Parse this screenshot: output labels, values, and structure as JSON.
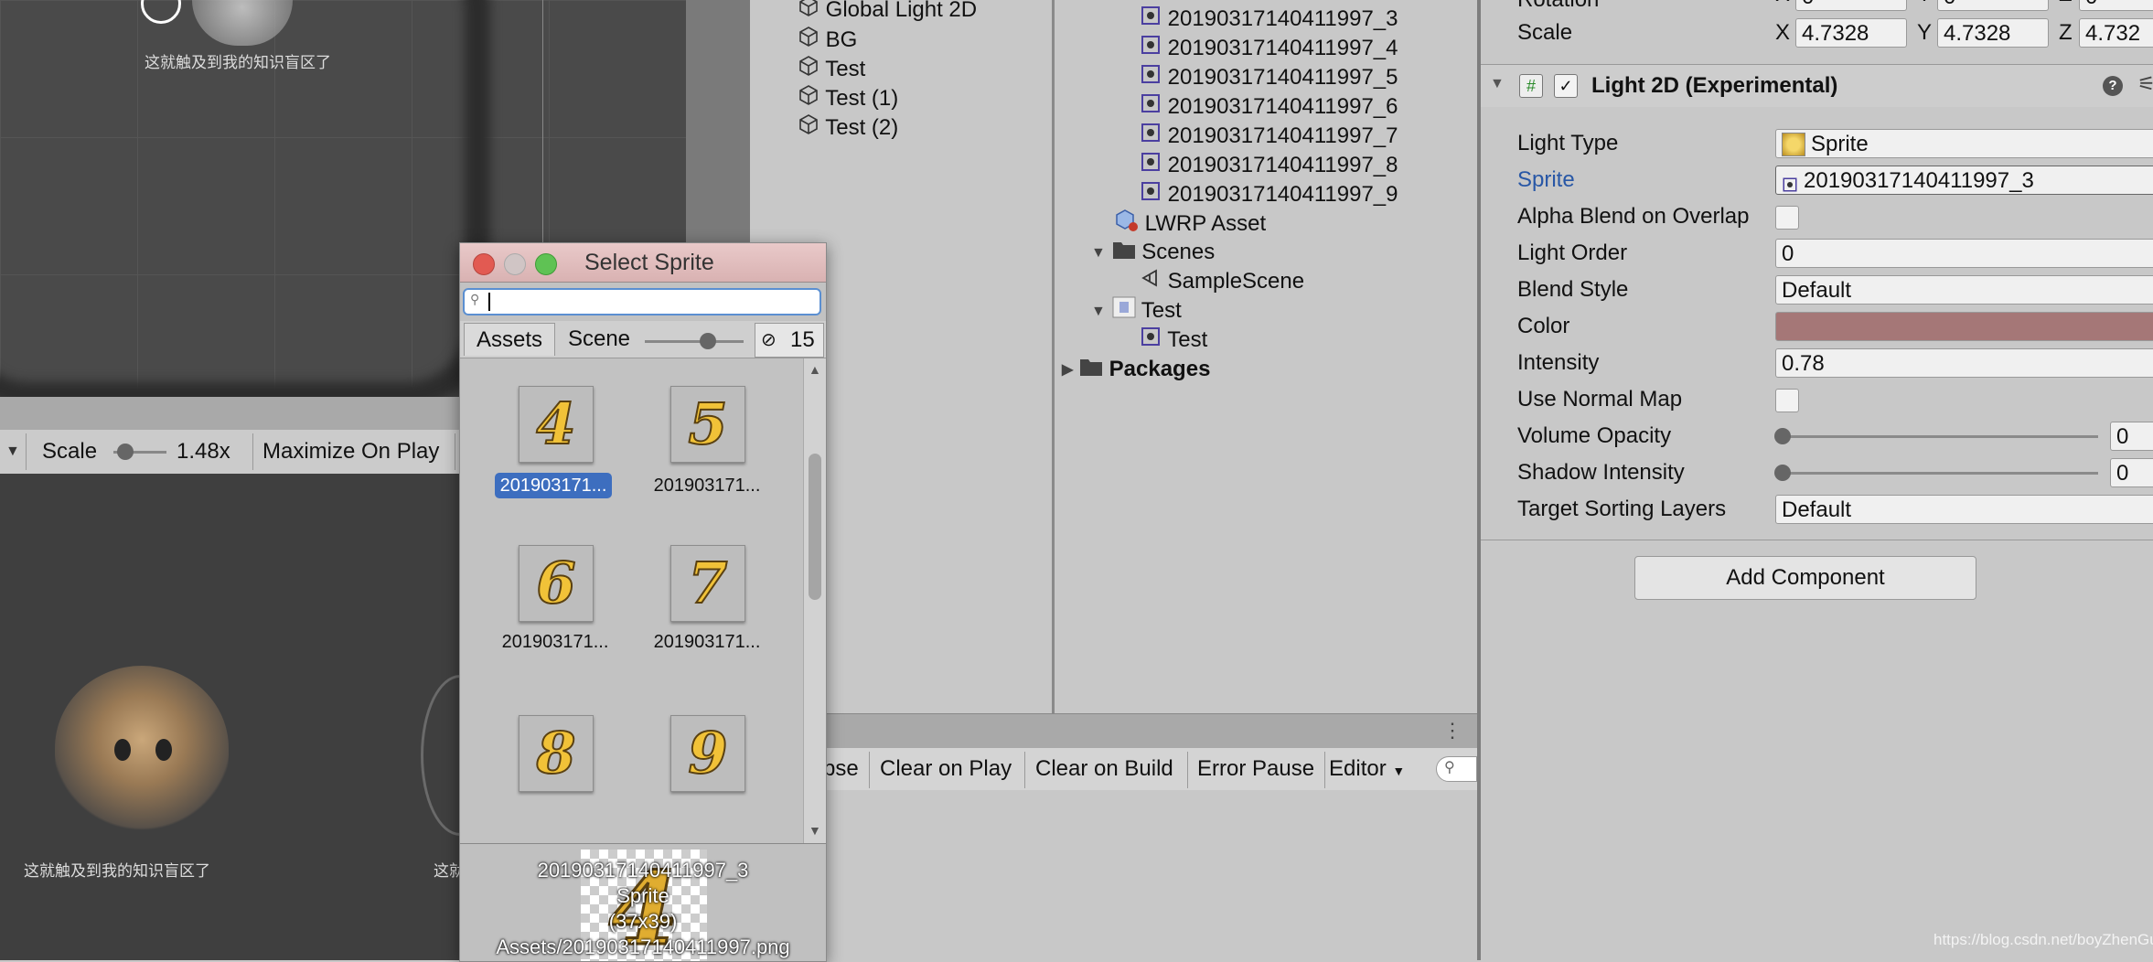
{
  "scene_caption_top": "这就触及到我的知识盲区了",
  "game_toolbar": {
    "scale_label": "Scale",
    "scale_value": "1.48x",
    "maximize": "Maximize On Play"
  },
  "game_caption": "这就触及到我的知识盲区了",
  "game_caption_partial": "这就",
  "hierarchy": {
    "items": [
      "Global Light 2D",
      "BG",
      "Test",
      "Test (1)",
      "Test (2)"
    ]
  },
  "project": {
    "sprites": [
      "20190317140411997_3",
      "20190317140411997_4",
      "20190317140411997_5",
      "20190317140411997_6",
      "20190317140411997_7",
      "20190317140411997_8",
      "20190317140411997_9"
    ],
    "lwrp": "LWRP Asset",
    "scenes_folder": "Scenes",
    "sample_scene": "SampleScene",
    "test_folder": "Test",
    "test_sprite": "Test",
    "packages": "Packages"
  },
  "console": {
    "collapse_partial": "pse",
    "clear_on_play": "Clear on Play",
    "clear_on_build": "Clear on Build",
    "error_pause": "Error Pause",
    "editor": "Editor"
  },
  "inspector": {
    "rotation_label": "Rotation",
    "scale_label": "Scale",
    "x": "X",
    "y": "Y",
    "z": "Z",
    "scale_x": "4.7328",
    "scale_y": "4.7328",
    "scale_z": "4.732",
    "rot_x": "0",
    "rot_y": "0",
    "rot_z": "0",
    "component_title": "Light 2D (Experimental)",
    "light_type_label": "Light Type",
    "light_type_value": "Sprite",
    "sprite_label": "Sprite",
    "sprite_value": "20190317140411997_3",
    "alpha_blend_label": "Alpha Blend on Overlap",
    "alpha_blend_checked": false,
    "light_order_label": "Light Order",
    "light_order_value": "0",
    "blend_style_label": "Blend Style",
    "blend_style_value": "Default",
    "color_label": "Color",
    "color_value": "#a57777",
    "intensity_label": "Intensity",
    "intensity_value": "0.78",
    "use_normal_map_label": "Use Normal Map",
    "use_normal_map_checked": false,
    "volume_opacity_label": "Volume Opacity",
    "volume_opacity_value": "0",
    "shadow_intensity_label": "Shadow Intensity",
    "shadow_intensity_value": "0",
    "target_sorting_label": "Target Sorting Layers",
    "target_sorting_value": "Default",
    "add_component": "Add Component"
  },
  "picker": {
    "title": "Select Sprite",
    "search_value": "",
    "tab_assets": "Assets",
    "tab_scene": "Scene",
    "hidden_count": "15",
    "items": [
      {
        "digit": "4",
        "label": "201903171...",
        "selected": true
      },
      {
        "digit": "5",
        "label": "201903171...",
        "selected": false
      },
      {
        "digit": "6",
        "label": "201903171...",
        "selected": false
      },
      {
        "digit": "7",
        "label": "201903171...",
        "selected": false
      },
      {
        "digit": "8",
        "label": "",
        "selected": false
      },
      {
        "digit": "9",
        "label": "",
        "selected": false
      }
    ],
    "preview_name": "20190317140411997_3",
    "preview_type": "Sprite",
    "preview_size": "(37x39)",
    "preview_path": "Assets/20190317140411997.png",
    "preview_digit": "4"
  },
  "watermark": "https://blog.csdn.net/boyZhenGui",
  "colors": {
    "selection": "#3d6ebf",
    "sprite_label_blue": "#2857a6",
    "light_color": "#a57777"
  }
}
